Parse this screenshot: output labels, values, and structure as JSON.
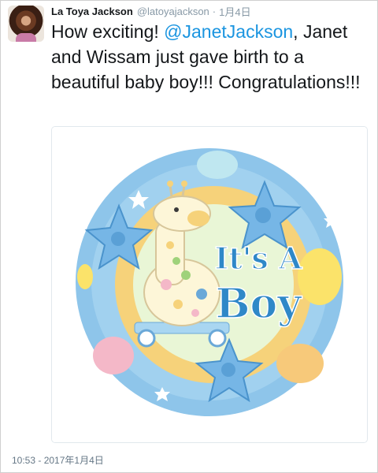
{
  "tweet": {
    "author_name": "La Toya Jackson",
    "author_handle": "@latoyajackson",
    "separator": "·",
    "date_short": "1月4日",
    "text_before": "How exciting! ",
    "mention": "@JanetJackson",
    "text_after": ", Janet and Wissam just gave birth to a beautiful baby boy!!! Congratulations!!!",
    "timestamp": "10:53 - 2017年1月4日"
  },
  "media": {
    "balloon_text_line1": "It's A",
    "balloon_text_line2": "Boy",
    "colors": {
      "outer_ring": "#8ec5ea",
      "inner_ring": "#f6d27a",
      "center": "#e9f6d6",
      "lettering": "#2f88c8",
      "star": "#76b6e6",
      "giraffe": "#fdf6d8"
    }
  }
}
